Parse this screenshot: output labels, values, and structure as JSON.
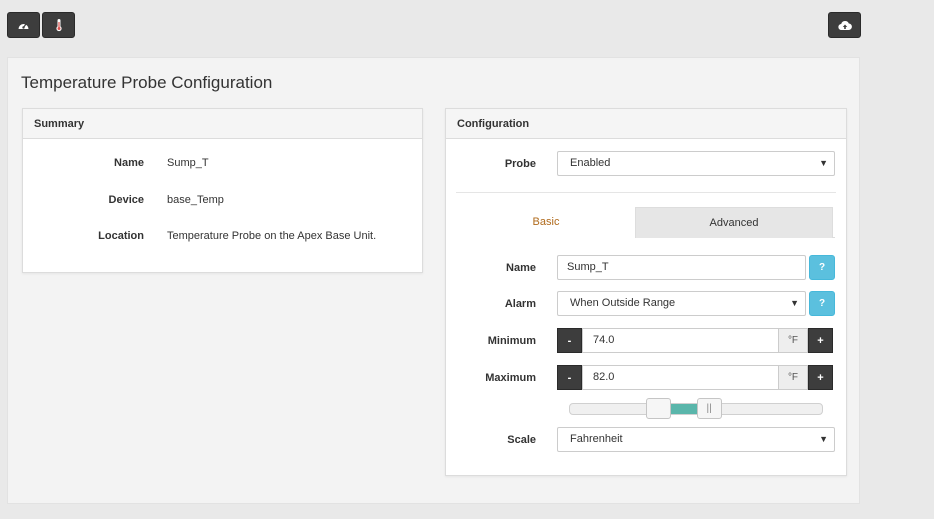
{
  "toolbar": {
    "dashboard_icon": "dashboard-gauge-icon",
    "thermometer_icon": "thermometer-icon",
    "upload_icon": "cloud-upload-icon"
  },
  "page": {
    "title": "Temperature Probe Configuration"
  },
  "summary": {
    "heading": "Summary",
    "rows": [
      {
        "label": "Name",
        "value": "Sump_T"
      },
      {
        "label": "Device",
        "value": "base_Temp"
      },
      {
        "label": "Location",
        "value": "Temperature Probe on the Apex Base Unit."
      }
    ]
  },
  "config": {
    "heading": "Configuration",
    "probe": {
      "label": "Probe",
      "value": "Enabled"
    },
    "tabs": {
      "basic": "Basic",
      "advanced": "Advanced"
    },
    "name": {
      "label": "Name",
      "value": "Sump_T",
      "help": "?"
    },
    "alarm": {
      "label": "Alarm",
      "value": "When Outside Range",
      "help": "?"
    },
    "minimum": {
      "label": "Minimum",
      "value": "74.0",
      "unit": "°F",
      "dec": "-",
      "inc": "+"
    },
    "maximum": {
      "label": "Maximum",
      "value": "82.0",
      "unit": "°F",
      "dec": "-",
      "inc": "+"
    },
    "range_slider": {
      "low_fraction": 0.35,
      "high_fraction": 0.55,
      "handle_glyph": "||"
    },
    "scale": {
      "label": "Scale",
      "value": "Fahrenheit"
    },
    "colors": {
      "accent_tab": "#b06a1b",
      "help": "#5bc0de",
      "slider_range": "#5ab6ab",
      "dark_button": "#3d3d3d"
    }
  }
}
